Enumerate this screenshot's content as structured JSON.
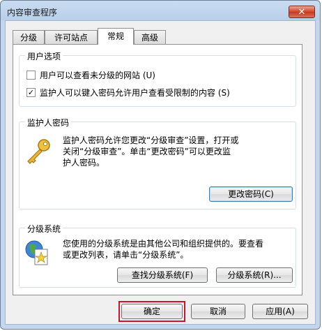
{
  "window": {
    "title": "内容审查程序",
    "close_label": "✕"
  },
  "tabs": [
    {
      "label": "分级",
      "active": false
    },
    {
      "label": "许可站点",
      "active": false
    },
    {
      "label": "常规",
      "active": true
    },
    {
      "label": "高级",
      "active": false
    }
  ],
  "user_options": {
    "title": "用户选项",
    "items": [
      {
        "label": "用户可以查看未分级的网站 (U)",
        "checked": false
      },
      {
        "label": "监护人可以键入密码允许用户查看受限制的内容 (S)",
        "checked": true
      }
    ]
  },
  "supervisor_password": {
    "title": "监护人密码",
    "description_line1": "监护人密码允许您更改“分级审查”设置，打开或",
    "description_line2": "关闭“分级审查”。单击“更改密码”可以更改监",
    "description_line3": "护人密码。",
    "icon": "key-icon",
    "change_password_button": "更改密码(C)"
  },
  "rating_systems": {
    "title": "分级系统",
    "description_line1": "您使用的分级系统是由其他公司和组织提供的。要查看",
    "description_line2": "或更改列表，请单击“分级系统”。",
    "icon": "rating-document-icon",
    "find_button": "查找分级系统(F)",
    "systems_button": "分级系统(R)..."
  },
  "footer": {
    "ok_button": "确定",
    "cancel_button": "取消",
    "apply_button": "应用(A)"
  },
  "colors": {
    "highlight": "#d0112b",
    "title_bar": "#c9dcf2",
    "close_button": "#d2442b"
  }
}
